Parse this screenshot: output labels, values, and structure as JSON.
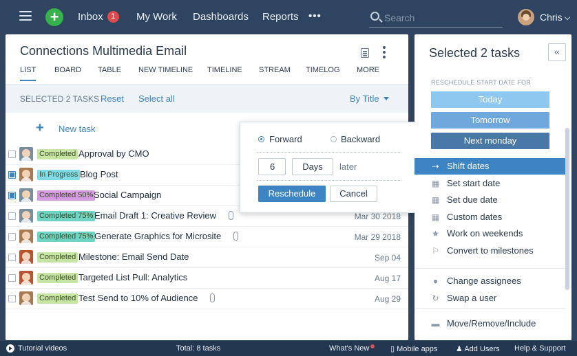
{
  "topbar": {
    "inbox_label": "Inbox",
    "inbox_count": "1",
    "my_work": "My Work",
    "dashboards": "Dashboards",
    "reports": "Reports",
    "more_dots": "•••",
    "search_placeholder": "Search",
    "user_name": "Chris"
  },
  "project": {
    "title": "Connections Multimedia Email",
    "tabs": [
      "LIST",
      "BOARD",
      "TABLE",
      "NEW TIMELINE",
      "TIMELINE",
      "STREAM",
      "TIMELOG",
      "MORE"
    ]
  },
  "selection": {
    "count_label": "SELECTED 2 TASKS",
    "reset": "Reset",
    "select_all": "Select all",
    "sort": "By Title"
  },
  "new_task": "New task",
  "status_colors": {
    "Completed": "#c6e5a2",
    "In Progress": "#7fdbe6",
    "Completed 50%": "#d59be0",
    "Completed 75%": "#6fd4c2"
  },
  "tasks": [
    {
      "status": "Completed",
      "name": "Approval by CMO",
      "date": "",
      "checked": false,
      "attach": false,
      "avatar": "#7a8f9c"
    },
    {
      "status": "In Progress",
      "name": "Blog Post",
      "date": "",
      "checked": true,
      "attach": false,
      "avatar": "#a77a52"
    },
    {
      "status": "Completed 50%",
      "name": "Social Campaign",
      "date": "",
      "checked": true,
      "attach": false,
      "avatar": "#7a8f9c"
    },
    {
      "status": "Completed 75%",
      "name": "Email Draft 1: Creative Review",
      "date": "Mar 30 2018",
      "checked": false,
      "attach": true,
      "avatar": "#7a8f9c"
    },
    {
      "status": "Completed 75%",
      "name": "Generate Graphics for Microsite",
      "date": "Mar 29 2018",
      "checked": false,
      "attach": true,
      "avatar": "#a77a52"
    },
    {
      "status": "Completed",
      "name": "Milestone: Email Send Date",
      "date": "Sep 04",
      "checked": false,
      "attach": false,
      "avatar": "#b8552e"
    },
    {
      "status": "Completed",
      "name": "Targeted List Pull: Analytics",
      "date": "Aug 17",
      "checked": false,
      "attach": false,
      "avatar": "#b8552e"
    },
    {
      "status": "Completed",
      "name": "Test Send to 10% of Audience",
      "date": "Aug 29",
      "checked": false,
      "attach": true,
      "avatar": "#a77a52"
    }
  ],
  "popover": {
    "forward": "Forward",
    "backward": "Backward",
    "amount": "6",
    "unit": "Days",
    "later": "later",
    "reschedule": "Reschedule",
    "cancel": "Cancel"
  },
  "panel": {
    "title": "Selected 2 tasks",
    "collapse": "«",
    "subheading": "RESCHEDULE START DATE FOR",
    "today": "Today",
    "tomorrow": "Tomorrow",
    "next_monday": "Next monday",
    "menu": [
      {
        "label": "Shift dates",
        "icon": "⇢"
      },
      {
        "label": "Set start date",
        "icon": "▦"
      },
      {
        "label": "Set due date",
        "icon": "▦"
      },
      {
        "label": "Custom dates",
        "icon": "▦"
      },
      {
        "label": "Work on weekends",
        "icon": "★"
      },
      {
        "label": "Convert to milestones",
        "icon": "⚐"
      }
    ],
    "menu2": [
      {
        "label": "Change assignees",
        "icon": "●"
      },
      {
        "label": "Swap a user",
        "icon": "↻"
      }
    ],
    "menu3": [
      {
        "label": "Move/Remove/Include",
        "icon": "▬"
      }
    ]
  },
  "bottombar": {
    "tutorial": "Tutorial videos",
    "total": "Total: 8 tasks",
    "whats_new": "What's New",
    "mobile": "Mobile apps",
    "add_users": "Add Users",
    "help": "Help & Support"
  }
}
